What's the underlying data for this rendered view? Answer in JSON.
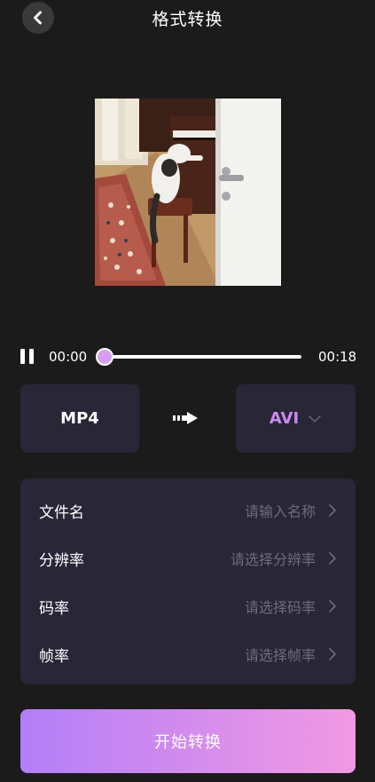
{
  "header": {
    "title": "格式转换",
    "back_icon": "chevron-left-icon"
  },
  "player": {
    "current_time": "00:00",
    "total_time": "00:18",
    "progress": 0.0,
    "state": "playing"
  },
  "format": {
    "source": "MP4",
    "target": "AVI",
    "arrow_icon": "arrow-right-icon",
    "dropdown_icon": "chevron-down-icon"
  },
  "settings": [
    {
      "label": "文件名",
      "value": "请输入名称"
    },
    {
      "label": "分辨率",
      "value": "请选择分辨率"
    },
    {
      "label": "码率",
      "value": "请选择码率"
    },
    {
      "label": "帧率",
      "value": "请选择帧率"
    }
  ],
  "start_button": {
    "label": "开始转换"
  },
  "colors": {
    "background": "#1c1b1b",
    "panel": "#282637",
    "accent": "#c98bf0",
    "thumb": "#d59ef0",
    "button_gradient_start": "#b37ef8",
    "button_gradient_end": "#f299e3",
    "placeholder": "#6f6d7c"
  }
}
